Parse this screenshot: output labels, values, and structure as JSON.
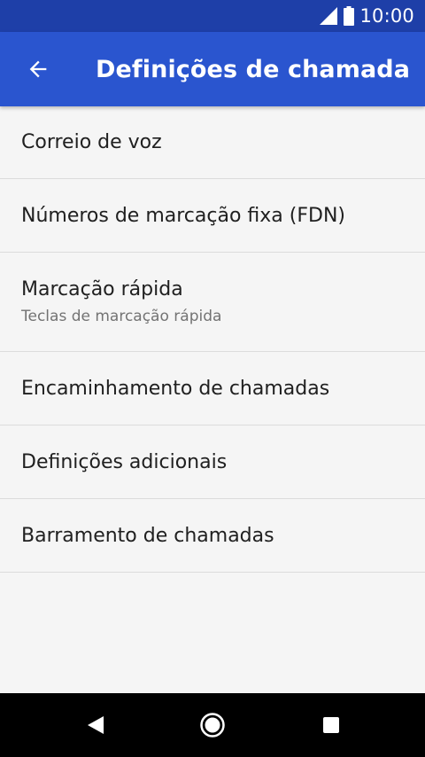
{
  "status_bar": {
    "time": "10:00",
    "icons": [
      "signal-icon",
      "battery-icon"
    ]
  },
  "app_bar": {
    "back_icon": "arrow-back-icon",
    "title": "Definições de chamada",
    "color": "#2a55cf",
    "status_color": "#1e3fa8"
  },
  "settings": [
    {
      "label": "Correio de voz"
    },
    {
      "label": "Números de marcação fixa (FDN)"
    },
    {
      "label": "Marcação rápida",
      "subtitle": "Teclas de marcação rápida"
    },
    {
      "label": "Encaminhamento de chamadas"
    },
    {
      "label": "Definições adicionais"
    },
    {
      "label": "Barramento de chamadas"
    }
  ],
  "nav_bar": {
    "icons": [
      "nav-back-icon",
      "nav-home-icon",
      "nav-recents-icon"
    ]
  }
}
